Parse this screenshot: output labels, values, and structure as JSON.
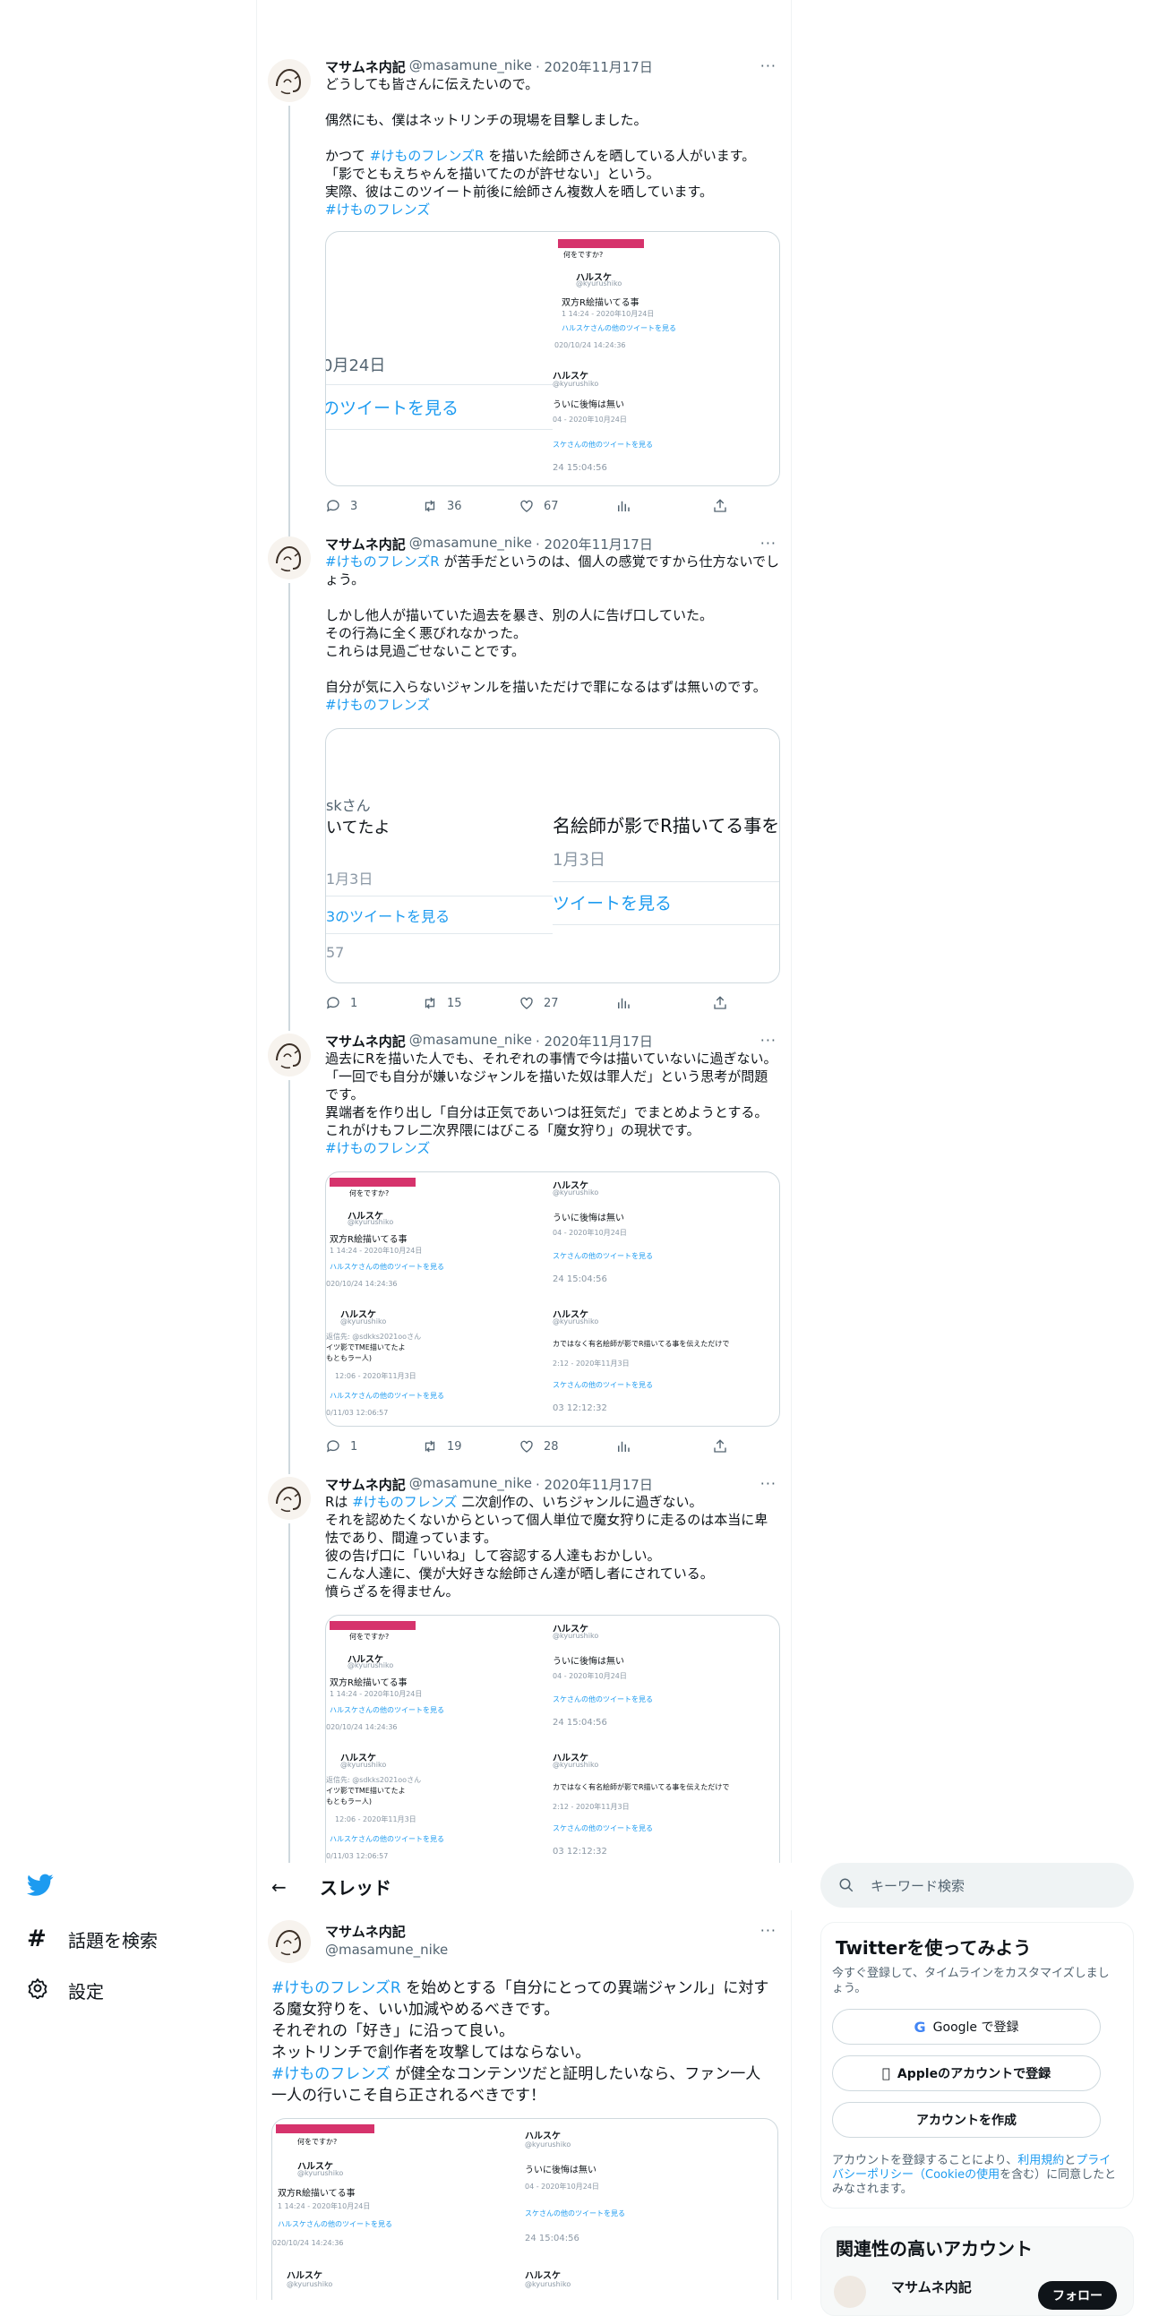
{
  "tweets": [
    {
      "name": "マサムネ内記",
      "handle": "@masamune_nike",
      "date": "· 2020年11月17日",
      "body": [
        {
          "t": "どうしても皆さんに伝えたいので。\n\n偶然にも、僕はネットリンチの現場を目撃しました。\n\nかつて "
        },
        {
          "h": "#けものフレンズR"
        },
        {
          "t": " を描いた絵師さんを晒している人がいます。\n「影でともえちゃんを描いてたのが許せない」という。\n実際、彼はこのツイート前後に絵師さん複数人を晒しています。\n"
        },
        {
          "h": "#けものフレンズ"
        }
      ],
      "replies": "3",
      "retweets": "36",
      "likes": "67"
    },
    {
      "name": "マサムネ内記",
      "handle": "@masamune_nike",
      "date": "· 2020年11月17日",
      "body": [
        {
          "h": "#けものフレンズR"
        },
        {
          "t": " が苦手だというのは、個人の感覚ですから仕方ないでしょう。\n\nしかし他人が描いていた過去を暴き、別の人に告げ口していた。\nその行為に全く悪びれなかった。\nこれらは見過ごせないことです。\n\n自分が気に入らないジャンルを描いただけで罪になるはずは無いのです。\n"
        },
        {
          "h": "#けものフレンズ"
        }
      ],
      "replies": "1",
      "retweets": "15",
      "likes": "27"
    },
    {
      "name": "マサムネ内記",
      "handle": "@masamune_nike",
      "date": "· 2020年11月17日",
      "body": [
        {
          "t": "過去にRを描いた人でも、それぞれの事情で今は描いていないに過ぎない。\n「一回でも自分が嫌いなジャンルを描いた奴は罪人だ」という思考が問題です。\n異端者を作り出し「自分は正気であいつは狂気だ」でまとめようとする。\nこれがけもフレ二次界隈にはびこる「魔女狩り」の現状です。\n"
        },
        {
          "h": "#けものフレンズ"
        }
      ],
      "replies": "1",
      "retweets": "19",
      "likes": "28"
    },
    {
      "name": "マサムネ内記",
      "handle": "@masamune_nike",
      "date": "· 2020年11月17日",
      "body": [
        {
          "t": "Rは "
        },
        {
          "h": "#けものフレンズ"
        },
        {
          "t": " 二次創作の、いちジャンルに過ぎない。\nそれを認めたくないからといって個人単位で魔女狩りに走るのは本当に卑怯であり、間違っています。\n彼の告げ口に「いいね」して容認する人達もおかしい。\nこんな人達に、僕が大好きな絵師さん達が晒し者にされている。\n憤らざるを得ません。"
        }
      ]
    }
  ],
  "shot": {
    "left_a": {
      "q": "何をですか?",
      "user": "ハルスケ",
      "uhandle": "@kyurushiko",
      "text": "双方R絵描いてる事",
      "meta": "1  14:24 - 2020年10月24日",
      "more": "ハルスケさんの他のツイートを見る",
      "ts": "020/10/24 14:24:36"
    },
    "left_a_date_big": "0月24日",
    "left_a_more_big": "のツイートを見る",
    "right_a": {
      "user": "ハルスケ",
      "uhandle": "@kyurushiko",
      "text": "ういに後悔は無い",
      "meta": "04 - 2020年10月24日",
      "more": "スケさんの他のツイートを見る",
      "ts": "24 15:04:56"
    },
    "left_b": {
      "user": "ハルスケ",
      "uhandle": "@kyurushiko",
      "reply": "返信先: @sdkks2021ooさん",
      "text": "イツ影でTME描いてたよ",
      "text2": "もともラー人)",
      "meta": "12:06 - 2020年11月3日",
      "more": "ハルスケさんの他のツイートを見る",
      "ts": "0/11/03 12:06:57"
    },
    "right_b": {
      "user": "ハルスケ",
      "uhandle": "@kyurushiko",
      "text": "カではなく有名絵師が影でR描いてる事を伝えただけで",
      "meta": "2:12 - 2020年11月3日",
      "more": "スケさんの他のツイートを見る",
      "ts": "03 12:12:32"
    },
    "zoom_l": {
      "a": "skさん",
      "b": "いてたよ",
      "c": "1月3日",
      "d": "3のツイートを見る",
      "e": "57"
    },
    "zoom_r": {
      "a": "名絵師が影でR描いてる事を",
      "b": "1月3日",
      "c": "ツイートを見る"
    }
  },
  "nav": {
    "search_label": "話題を検索",
    "settings_label": "設定"
  },
  "thread_header": {
    "back": "←",
    "title": "スレッド"
  },
  "main_tweet": {
    "name": "マサムネ内記",
    "handle": "@masamune_nike",
    "body": [
      {
        "h": "#けものフレンズR"
      },
      {
        "t": " を始めとする「自分にとっての異端ジャンル」に対する魔女狩りを、いい加減やめるべきです。\nそれぞれの「好き」に沿って良い。\nネットリンチで創作者を攻撃してはならない。\n"
      },
      {
        "h": "#けものフレンズ"
      },
      {
        "t": " が健全なコンテンツだと証明したいなら、ファン一人一人の行いこそ自ら正されるべきです！"
      }
    ]
  },
  "right": {
    "search_placeholder": "キーワード検索",
    "signup_title": "Twitterを使ってみよう",
    "signup_sub": "今すぐ登録して、タイムラインをカスタマイズしましょう。",
    "google_btn": "Google で登録",
    "apple_btn": "Appleのアカウントで登録",
    "create_btn": "アカウントを作成",
    "terms_pre": "アカウントを登録することにより、",
    "terms_link1": "利用規約",
    "terms_mid": "と",
    "terms_link2": "プライバシーポリシー（Cookieの使用",
    "terms_post": "を含む）に同意したとみなされます。",
    "related_title": "関連性の高いアカウント",
    "related_name": "マサムネ内記",
    "follow_btn": "フォロー"
  },
  "colors": {
    "accent": "#1d9bf0",
    "text": "#0f1419",
    "muted": "#536471",
    "redact": "#d6336c"
  }
}
